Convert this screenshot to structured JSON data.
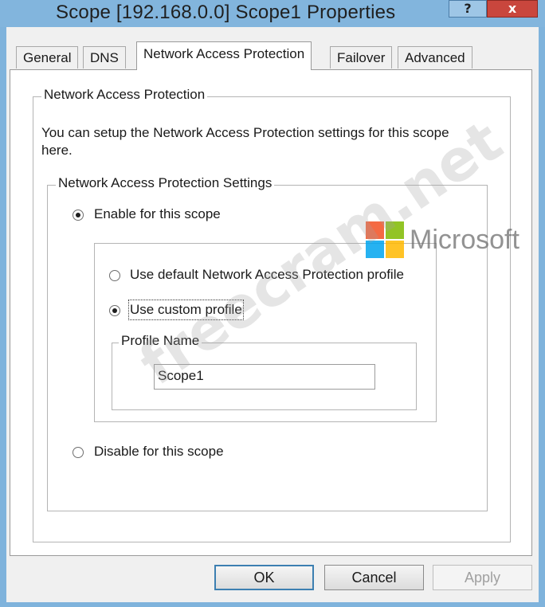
{
  "window": {
    "title": "Scope [192.168.0.0] Scope1 Properties",
    "help_label": "?",
    "close_label": "x"
  },
  "tabs": [
    {
      "label": "General",
      "active": false
    },
    {
      "label": "DNS",
      "active": false
    },
    {
      "label": "Network Access Protection",
      "active": true
    },
    {
      "label": "Failover",
      "active": false
    },
    {
      "label": "Advanced",
      "active": false
    }
  ],
  "nap": {
    "group_title": "Network Access Protection",
    "description_line1": "You can setup the Network Access Protection settings for this scope",
    "description_line2": "here.",
    "settings_title": "Network Access Protection Settings",
    "enable_label": "Enable for this scope",
    "enable_checked": true,
    "use_default_label": "Use default Network Access Protection profile",
    "use_default_checked": false,
    "use_custom_label": "Use custom profile",
    "use_custom_checked": true,
    "profile_name_title": "Profile Name",
    "profile_name_value": "Scope1",
    "disable_label": "Disable for this scope",
    "disable_checked": false
  },
  "buttons": {
    "ok": "OK",
    "cancel": "Cancel",
    "apply": "Apply"
  },
  "watermark": {
    "text": "freecram.net",
    "brand": "Microsoft",
    "logo_colors": [
      "#f25022",
      "#7fba00",
      "#00a4ef",
      "#ffb900"
    ]
  },
  "colors": {
    "titlebar": "#82b5dd",
    "close": "#c9463d",
    "default_button_border": "#3c7fb1"
  }
}
